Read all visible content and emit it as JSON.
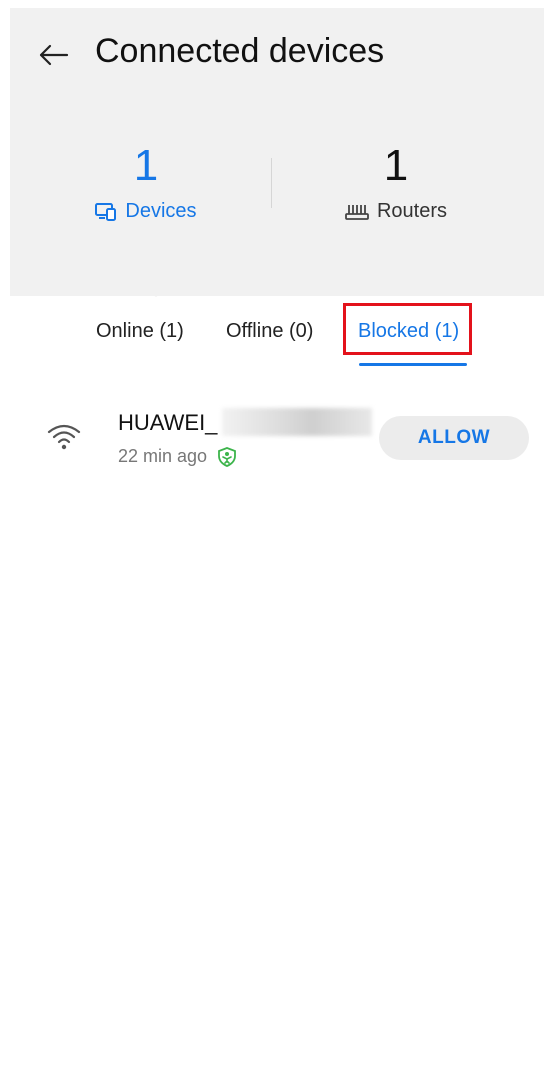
{
  "header": {
    "title": "Connected devices",
    "back_icon": "arrow-left-icon",
    "devices_count": "1",
    "devices_label": "Devices",
    "devices_icon": "devices-icon",
    "routers_count": "1",
    "routers_label": "Routers",
    "routers_icon": "router-icon"
  },
  "tabs": {
    "online": "Online (1)",
    "offline": "Offline (0)",
    "blocked": "Blocked (1)",
    "selected": "blocked"
  },
  "device": {
    "name": "HUAWEI_",
    "time": "22 min ago",
    "signal_icon": "wifi-icon",
    "status_icon": "child-safe-icon",
    "action": "ALLOW"
  },
  "colors": {
    "accent": "#1677e6",
    "highlight": "#e3121b",
    "status_green": "#3cb44b",
    "header_bg": "#f1f1f1"
  }
}
